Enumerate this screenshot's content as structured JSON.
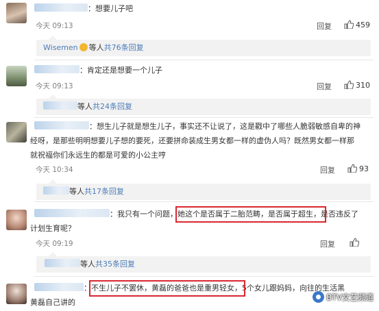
{
  "comments": [
    {
      "text": "：想要儿子吧",
      "time": "今天 09:13",
      "reply_label": "回复",
      "likes": "459",
      "sub": {
        "user": "Wisemen",
        "mid": "等人",
        "count_text": "共76条回复"
      }
    },
    {
      "text": "：肯定还是想要一个儿子",
      "time": "今天 09:13",
      "reply_label": "回复",
      "likes": "310",
      "sub": {
        "mid": "等人",
        "count_text": "共24条回复"
      }
    },
    {
      "line1": "：想生儿子就是想生儿子，事实还不让说了，这是戳中了哪些人脆弱敏感自卑的神",
      "line2": "经呀，是那些明明想要儿子想的要死，还要拼命装成生男女都一样的虚伪人吗？既然男女都一样那",
      "line3": "就祝福你们永远生的都是可爱的小公主哼",
      "time": "今天 10:34",
      "reply_label": "回复",
      "likes": "93",
      "sub": {
        "mid": "等人",
        "count_text": "共17条回复"
      }
    },
    {
      "line1_a": "：我只有一个问题，",
      "line1_b": "她这个是否属于二胎范畴，是否属于超生",
      "line1_c": "，是否违反了",
      "line2": "计划生育呢？",
      "time": "今天 09:19",
      "reply_label": "回复",
      "likes": "",
      "sub": {
        "mid": "等人",
        "count_text": "共35条回复"
      }
    },
    {
      "line1_a": "：",
      "line1_b": "不生儿子不罢休，黄磊的爸爸也是重男轻女",
      "line1_c": "，5个女儿跟妈妈",
      "line1_d": "，向往的生活黑",
      "line2": "黄磊自己讲的"
    }
  ],
  "watermark": "BTV文艺频道",
  "colors": {
    "highlight_box": "#d8262f",
    "link_blue": "#4a7cb8",
    "sub_bg": "#f2f2f2"
  }
}
